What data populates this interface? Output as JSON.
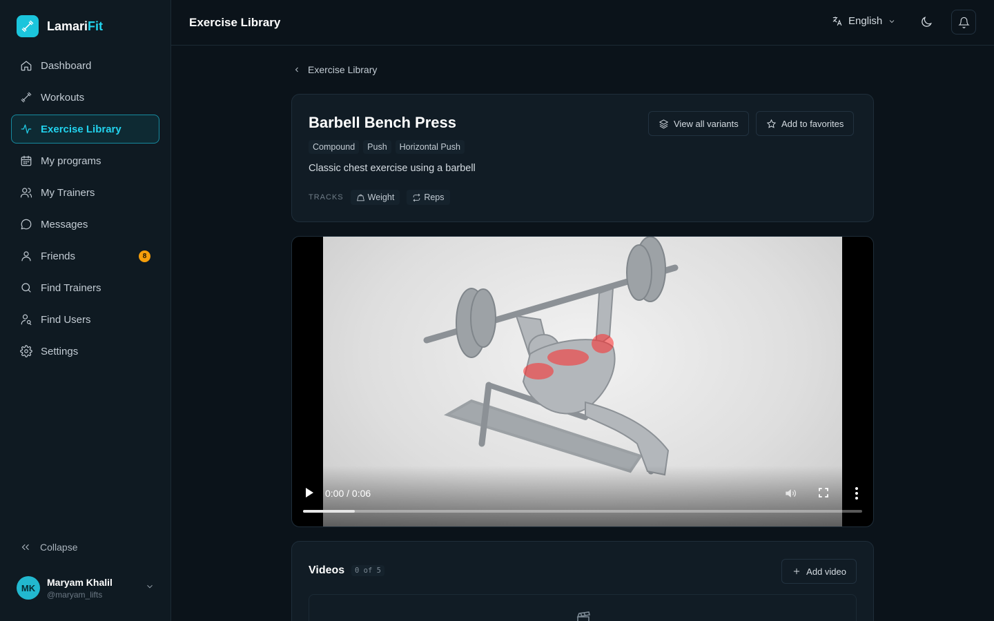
{
  "brand": {
    "name_main": "Lamari",
    "name_accent": "Fit"
  },
  "sidebar": {
    "items": [
      {
        "label": "Dashboard",
        "icon": "home-icon"
      },
      {
        "label": "Workouts",
        "icon": "dumbbell-icon"
      },
      {
        "label": "Exercise Library",
        "icon": "activity-icon",
        "active": true
      },
      {
        "label": "My programs",
        "icon": "calendar-icon"
      },
      {
        "label": "My Trainers",
        "icon": "users-icon"
      },
      {
        "label": "Messages",
        "icon": "message-icon"
      },
      {
        "label": "Friends",
        "icon": "user-icon",
        "badge": "8"
      },
      {
        "label": "Find Trainers",
        "icon": "search-icon"
      },
      {
        "label": "Find Users",
        "icon": "user-search-icon"
      },
      {
        "label": "Settings",
        "icon": "gear-icon"
      }
    ],
    "collapse_label": "Collapse",
    "user": {
      "initials": "MK",
      "name": "Maryam Khalil",
      "handle": "@maryam_lifts"
    }
  },
  "header": {
    "title": "Exercise Library",
    "language": "English"
  },
  "breadcrumb": {
    "back_label": "Exercise Library"
  },
  "exercise": {
    "title": "Barbell Bench Press",
    "tags": [
      "Compound",
      "Push",
      "Horizontal Push"
    ],
    "description": "Classic chest exercise using a barbell",
    "tracks_label": "TRACKS",
    "tracks": [
      "Weight",
      "Reps"
    ],
    "view_variants_label": "View all variants",
    "favorites_label": "Add to favorites"
  },
  "video": {
    "time": "0:00 / 0:06",
    "progress_fraction": 0.093
  },
  "videos_section": {
    "title": "Videos",
    "count": "0 of 5",
    "add_label": "Add video"
  },
  "colors": {
    "accent": "#22d3ee",
    "badge": "#f59e0b",
    "background": "#0b131a"
  }
}
